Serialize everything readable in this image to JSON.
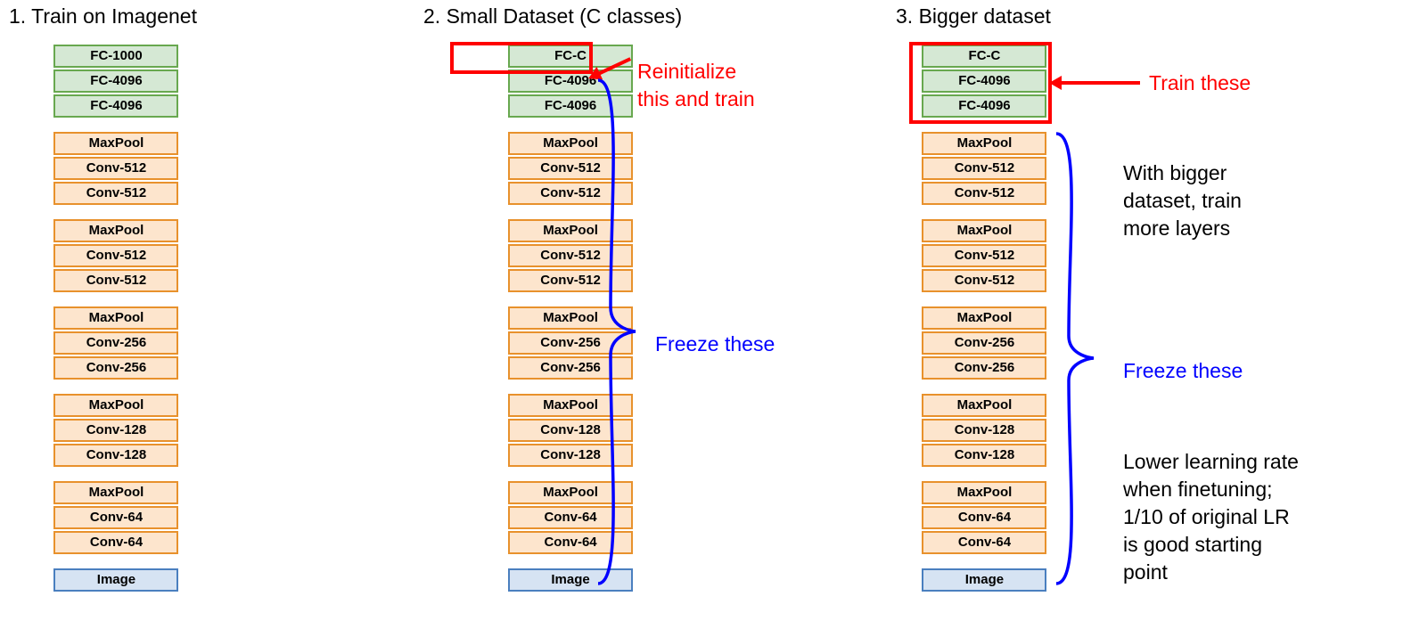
{
  "columns": [
    {
      "title": "1. Train on Imagenet",
      "groups": [
        [
          {
            "t": "FC-1000",
            "c": "fc"
          },
          {
            "t": "FC-4096",
            "c": "fc"
          },
          {
            "t": "FC-4096",
            "c": "fc"
          }
        ],
        [
          {
            "t": "MaxPool",
            "c": "conv"
          },
          {
            "t": "Conv-512",
            "c": "conv"
          },
          {
            "t": "Conv-512",
            "c": "conv"
          }
        ],
        [
          {
            "t": "MaxPool",
            "c": "conv"
          },
          {
            "t": "Conv-512",
            "c": "conv"
          },
          {
            "t": "Conv-512",
            "c": "conv"
          }
        ],
        [
          {
            "t": "MaxPool",
            "c": "conv"
          },
          {
            "t": "Conv-256",
            "c": "conv"
          },
          {
            "t": "Conv-256",
            "c": "conv"
          }
        ],
        [
          {
            "t": "MaxPool",
            "c": "conv"
          },
          {
            "t": "Conv-128",
            "c": "conv"
          },
          {
            "t": "Conv-128",
            "c": "conv"
          }
        ],
        [
          {
            "t": "MaxPool",
            "c": "conv"
          },
          {
            "t": "Conv-64",
            "c": "conv"
          },
          {
            "t": "Conv-64",
            "c": "conv"
          }
        ],
        [
          {
            "t": "Image",
            "c": "img"
          }
        ]
      ]
    },
    {
      "title": "2. Small Dataset (C classes)",
      "groups": [
        [
          {
            "t": "FC-C",
            "c": "fc"
          },
          {
            "t": "FC-4096",
            "c": "fc"
          },
          {
            "t": "FC-4096",
            "c": "fc"
          }
        ],
        [
          {
            "t": "MaxPool",
            "c": "conv"
          },
          {
            "t": "Conv-512",
            "c": "conv"
          },
          {
            "t": "Conv-512",
            "c": "conv"
          }
        ],
        [
          {
            "t": "MaxPool",
            "c": "conv"
          },
          {
            "t": "Conv-512",
            "c": "conv"
          },
          {
            "t": "Conv-512",
            "c": "conv"
          }
        ],
        [
          {
            "t": "MaxPool",
            "c": "conv"
          },
          {
            "t": "Conv-256",
            "c": "conv"
          },
          {
            "t": "Conv-256",
            "c": "conv"
          }
        ],
        [
          {
            "t": "MaxPool",
            "c": "conv"
          },
          {
            "t": "Conv-128",
            "c": "conv"
          },
          {
            "t": "Conv-128",
            "c": "conv"
          }
        ],
        [
          {
            "t": "MaxPool",
            "c": "conv"
          },
          {
            "t": "Conv-64",
            "c": "conv"
          },
          {
            "t": "Conv-64",
            "c": "conv"
          }
        ],
        [
          {
            "t": "Image",
            "c": "img"
          }
        ]
      ],
      "annot_red": "Reinitialize\nthis and train",
      "annot_blue": "Freeze these"
    },
    {
      "title": "3. Bigger dataset",
      "groups": [
        [
          {
            "t": "FC-C",
            "c": "fc"
          },
          {
            "t": "FC-4096",
            "c": "fc"
          },
          {
            "t": "FC-4096",
            "c": "fc"
          }
        ],
        [
          {
            "t": "MaxPool",
            "c": "conv"
          },
          {
            "t": "Conv-512",
            "c": "conv"
          },
          {
            "t": "Conv-512",
            "c": "conv"
          }
        ],
        [
          {
            "t": "MaxPool",
            "c": "conv"
          },
          {
            "t": "Conv-512",
            "c": "conv"
          },
          {
            "t": "Conv-512",
            "c": "conv"
          }
        ],
        [
          {
            "t": "MaxPool",
            "c": "conv"
          },
          {
            "t": "Conv-256",
            "c": "conv"
          },
          {
            "t": "Conv-256",
            "c": "conv"
          }
        ],
        [
          {
            "t": "MaxPool",
            "c": "conv"
          },
          {
            "t": "Conv-128",
            "c": "conv"
          },
          {
            "t": "Conv-128",
            "c": "conv"
          }
        ],
        [
          {
            "t": "MaxPool",
            "c": "conv"
          },
          {
            "t": "Conv-64",
            "c": "conv"
          },
          {
            "t": "Conv-64",
            "c": "conv"
          }
        ],
        [
          {
            "t": "Image",
            "c": "img"
          }
        ]
      ],
      "annot_red": "Train these",
      "annot_blue": "Freeze these",
      "annot_black1": "With bigger\ndataset, train\nmore layers",
      "annot_black2": "Lower learning rate\nwhen finetuning;\n1/10 of original LR\nis good starting\npoint"
    }
  ]
}
